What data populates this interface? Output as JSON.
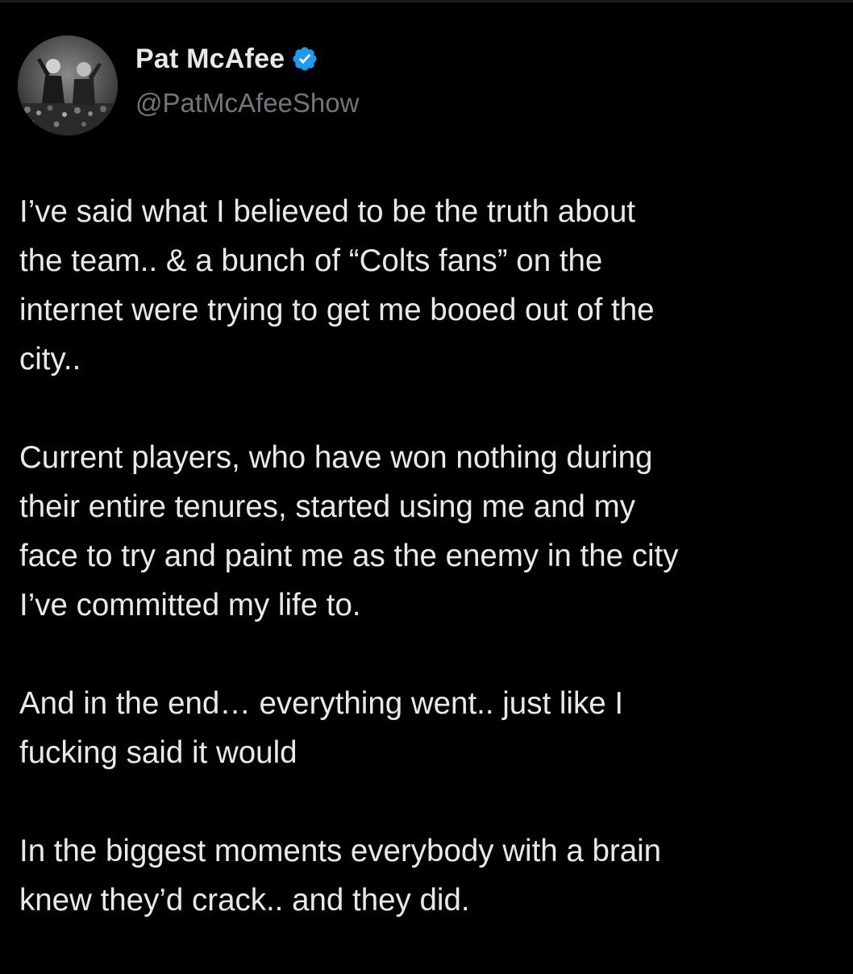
{
  "tweet": {
    "author": {
      "display_name": "Pat McAfee",
      "handle": "@PatMcAfeeShow",
      "verified": true,
      "verified_color": "#1d9bf0"
    },
    "paragraphs": [
      "I’ve said what I believed to be the truth about\nthe team.. & a bunch of “Colts fans” on the\ninternet were trying to get me booed out of the\ncity..",
      "Current players, who have won nothing during\ntheir entire tenures, started using me and my\nface to try and paint me as the enemy in the city\nI’ve committed my life to.",
      "And in the end… everything went.. just like I\nfucking said it would",
      "In the biggest moments everybody with a brain\nknew they’d crack.. and they did."
    ]
  },
  "theme": {
    "background": "#000000",
    "text": "#e7e9ea",
    "secondary_text": "#71767b"
  }
}
